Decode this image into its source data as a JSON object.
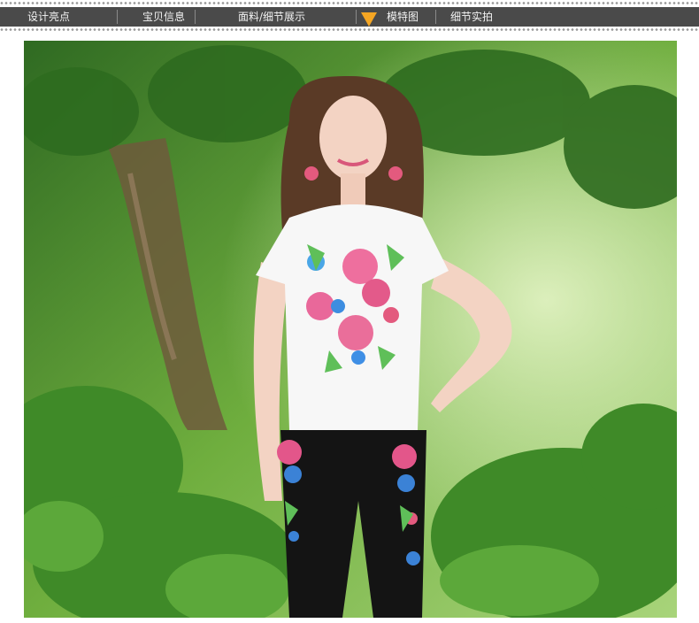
{
  "nav": {
    "items": [
      {
        "label": "设计亮点"
      },
      {
        "label": "宝贝信息"
      },
      {
        "label": "面料/细节展示"
      },
      {
        "label": "模特图"
      },
      {
        "label": "细节实拍"
      }
    ],
    "active_index": 3,
    "colors": {
      "bar": "#4a4a4a",
      "text": "#f2f2f2",
      "pointer": "#f5a623"
    }
  },
  "photo": {
    "icon": "model-photo"
  }
}
